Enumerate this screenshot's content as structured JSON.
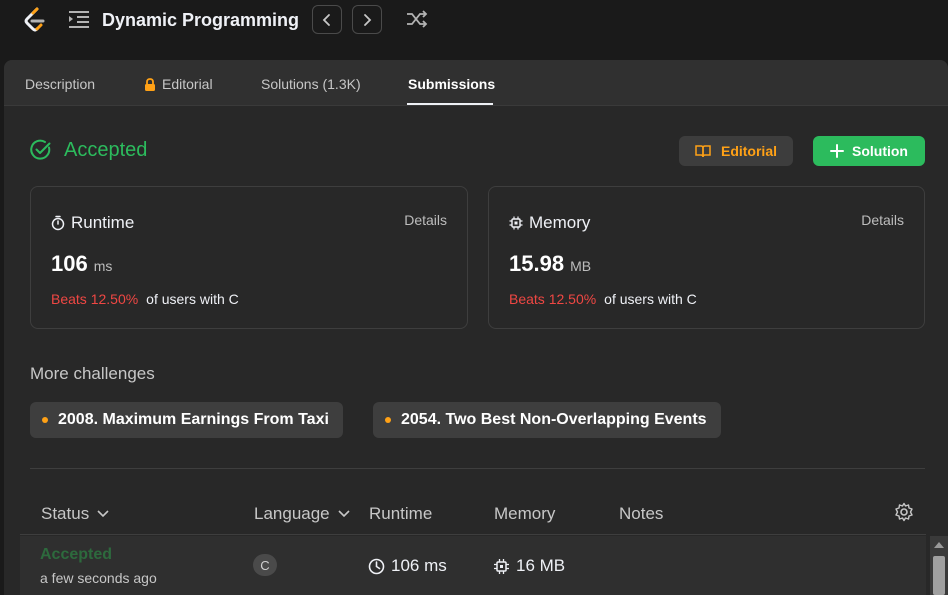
{
  "topbar": {
    "title": "Dynamic Programming"
  },
  "tabs": [
    {
      "label": "Description"
    },
    {
      "label": "Editorial",
      "locked": true
    },
    {
      "label": "Solutions (1.3K)"
    },
    {
      "label": "Submissions",
      "active": true
    }
  ],
  "result": {
    "status": "Accepted",
    "editorial_button": "Editorial",
    "solution_button": "Solution"
  },
  "runtime_card": {
    "title": "Runtime",
    "details": "Details",
    "value": "106",
    "unit": "ms",
    "beats": "Beats 12.50%",
    "beats_suffix": "of users with C"
  },
  "memory_card": {
    "title": "Memory",
    "details": "Details",
    "value": "15.98",
    "unit": "MB",
    "beats": "Beats 12.50%",
    "beats_suffix": "of users with C"
  },
  "challenges": {
    "heading": "More challenges",
    "items": [
      {
        "label": "2008. Maximum Earnings From Taxi"
      },
      {
        "label": "2054. Two Best Non-Overlapping Events"
      }
    ]
  },
  "table": {
    "headers": [
      "Status",
      "Language",
      "Runtime",
      "Memory",
      "Notes"
    ],
    "rows": [
      {
        "status": "Accepted",
        "time": "a few seconds ago",
        "language": "C",
        "runtime": "106 ms",
        "memory": "16 MB"
      }
    ]
  },
  "colors": {
    "accent_green": "#2cbb5d",
    "accent_orange": "#ffa116",
    "beats_red": "#ef4743"
  }
}
